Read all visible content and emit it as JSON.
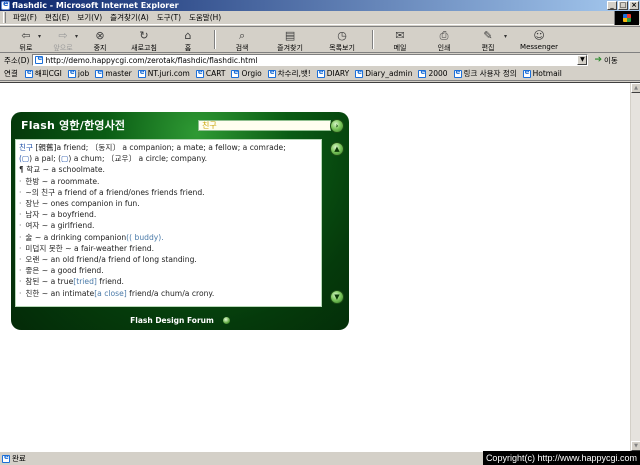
{
  "window": {
    "title": "flashdic - Microsoft Internet Explorer",
    "minimize": "_",
    "maximize": "□",
    "close": "×"
  },
  "menubar": {
    "items": [
      "파일(F)",
      "편집(E)",
      "보기(V)",
      "즐겨찾기(A)",
      "도구(T)",
      "도움말(H)"
    ]
  },
  "toolbar": {
    "back": "뒤로",
    "forward": "앞으로",
    "stop": "중지",
    "refresh": "새로고침",
    "home": "홈",
    "search": "검색",
    "favorites": "즐겨찾기",
    "history": "목록보기",
    "mail": "메일",
    "print": "인쇄",
    "edit": "편집",
    "messenger": "Messenger"
  },
  "address": {
    "label": "주소(D)",
    "url": "http://demo.happycgi.com/zerotak/flashdic/flashdic.html",
    "go": "이동"
  },
  "links": {
    "label": "연결",
    "items": [
      "해피CGI",
      "job",
      "master",
      "NT.juri.com",
      "CART",
      "Orgio",
      "차수리,뱃!",
      "DIARY",
      "Diary_admin",
      "2000",
      "링크 사용자 정의",
      "Hotmail"
    ]
  },
  "dictionary": {
    "logo": "Flash 영한/한영사전",
    "search_value": "친구",
    "footer": "Flash Design Forum",
    "entry": {
      "head": "친구",
      "hanja": "[親舊]",
      "line1_rest": "a friend;  〔동지〕 a companion;  a mate;  a fellow;  a comrade;",
      "line2_a": "(",
      "line2_b": ") a pal;  (",
      "line2_c": ") a chum;  〔교우〕 a circle;  company.",
      "sense_mark": "¶",
      "sense_text": "학교 ~ a schoolmate."
    },
    "examples": [
      {
        "ko": "한방 ~",
        "en": "a roommate.",
        "extra": ""
      },
      {
        "ko": "~의 친구",
        "en": "a friend of a friend/ones friends friend.",
        "extra": ""
      },
      {
        "ko": "장난 ~",
        "en": "ones companion in fun.",
        "extra": ""
      },
      {
        "ko": "남자 ~",
        "en": "a boyfriend.",
        "extra": ""
      },
      {
        "ko": "여자 ~",
        "en": "a girlfriend.",
        "extra": ""
      },
      {
        "ko": "술 ~",
        "en": "a drinking companion",
        "extra": "(( buddy)."
      },
      {
        "ko": "미덥지 못한 ~",
        "en": "a fair-weather friend.",
        "extra": ""
      },
      {
        "ko": "오랜 ~",
        "en": "an old friend/a friend of long standing.",
        "extra": ""
      },
      {
        "ko": "좋은 ~",
        "en": "a good friend.",
        "extra": ""
      },
      {
        "ko": "참된 ~",
        "en": "a true",
        "extra": "[tried]",
        "tail": " friend."
      },
      {
        "ko": "친한 ~",
        "en": "an intimate",
        "extra": "[a close]",
        "tail": " friend/a chum/a crony."
      }
    ]
  },
  "status": {
    "text": "완료",
    "copyright": "Copyright(c) http://www.happycgi.com"
  }
}
